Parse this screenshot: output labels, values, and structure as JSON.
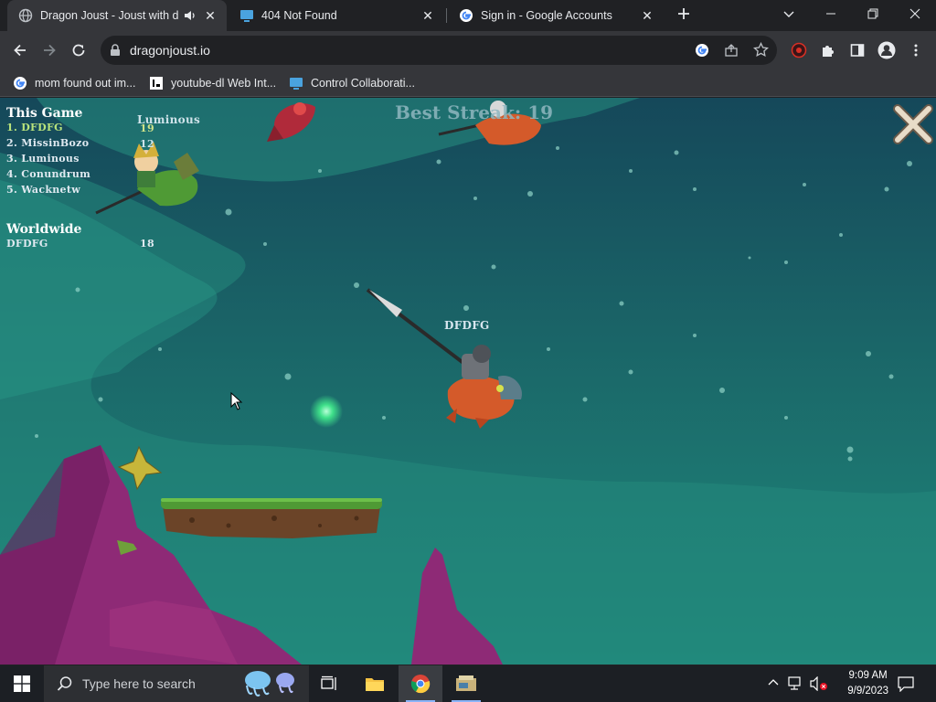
{
  "browser": {
    "tabs": [
      {
        "title": "Dragon Joust - Joust with dr",
        "active": true,
        "audio": true
      },
      {
        "title": "404 Not Found",
        "active": false
      },
      {
        "title": "Sign in - Google Accounts",
        "active": false
      }
    ],
    "new_tab_icon": "plus-icon",
    "url": "dragonjoust.io",
    "bookmarks": [
      {
        "label": "mom found out im...",
        "icon": "google-icon"
      },
      {
        "label": "youtube-dl Web Int...",
        "icon": "page-icon"
      },
      {
        "label": "Control Collaborati...",
        "icon": "monitor-icon"
      }
    ]
  },
  "game": {
    "leaderboard": {
      "this_game_title": "This Game",
      "entries": [
        {
          "rank_name": "1. DFDFG",
          "current": true
        },
        {
          "rank_name": "2. MissinBozo"
        },
        {
          "rank_name": "3. Luminous"
        },
        {
          "rank_name": "4. Conundrum"
        },
        {
          "rank_name": "5. Wacknetw"
        }
      ],
      "worldwide_title": "Worldwide",
      "worldwide_entry": {
        "name": "DFDFG",
        "score": "18"
      }
    },
    "best_streak": "Best Streak: 19",
    "players": {
      "luminous": {
        "name": "Luminous",
        "score": "19"
      },
      "luminous_score_2": "12",
      "self": {
        "name": "DFDFG"
      }
    },
    "close_icon": "close-x-icon"
  },
  "taskbar": {
    "search_placeholder": "Type here to search",
    "time": "9:09 AM",
    "date": "9/9/2023"
  },
  "colors": {
    "sky": "#1f6e6a",
    "aurora": "#3fb7a1",
    "cliff": "#8e2a76",
    "grass": "#4f9a35",
    "dirt": "#6b4428"
  }
}
